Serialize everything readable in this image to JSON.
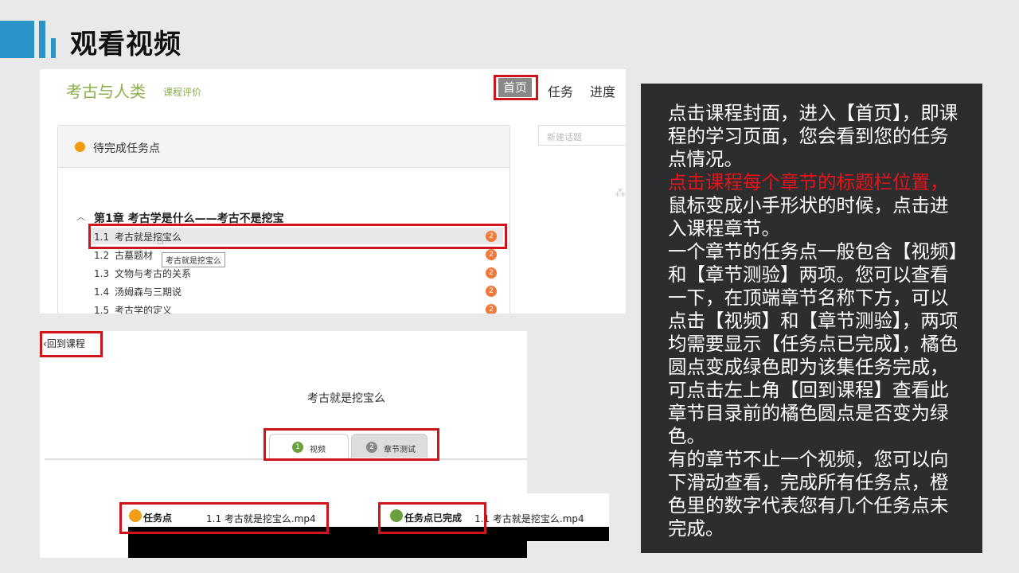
{
  "slide": {
    "title": "观看视频"
  },
  "course_page": {
    "course_title": "考古与人类",
    "course_eval": "课程评价",
    "nav": {
      "home": "首页",
      "task": "任务",
      "progress": "进度"
    },
    "pending_card": {
      "title": "待完成任务点"
    },
    "new_topic_placeholder": "新建话题",
    "chapter": {
      "title": "第1章 考古学是什么——考古不是挖宝",
      "expanded": true
    },
    "sections": [
      {
        "num": "1.1",
        "title": "考古就是挖宝么",
        "badge": "2"
      },
      {
        "num": "1.2",
        "title": "古墓题材",
        "badge": "2"
      },
      {
        "num": "1.3",
        "title": "文物与考古的关系",
        "badge": "2"
      },
      {
        "num": "1.4",
        "title": "汤姆森与三期说",
        "badge": "2"
      },
      {
        "num": "1.5",
        "title": "考古学的定义",
        "badge": "2"
      }
    ],
    "tooltip": "考古就是挖宝么"
  },
  "chapter_page": {
    "back_label": "回到课程",
    "title": "考古就是挖宝么",
    "tabs": [
      {
        "num": "1",
        "label": "视频",
        "color": "#6aa13c",
        "active": true
      },
      {
        "num": "2",
        "label": "章节测试",
        "color": "#888888",
        "active": false
      }
    ],
    "task_pending": {
      "label": "任务点",
      "file": "1.1 考古就是挖宝么.mp4",
      "dot_color": "#f0a018"
    },
    "task_done": {
      "label": "任务点已完成",
      "file": "1.1 考古就是挖宝么.mp4",
      "dot_color": "#6aa13c"
    }
  },
  "instructions": {
    "p1": "点击课程封面，进入【首页】，即课程的学习页面，您会看到您的任务点情况。",
    "p2_red": "点击课程每个章节的标题栏位置，",
    "p3": "鼠标变成小手形状的时候，点击进入课程章节。",
    "p4": "一个章节的任务点一般包含【视频】和【章节测验】两项。您可以查看一下，在顶端章节名称下方，可以点击【视频】和【章节测验】，两项均需要显示【任务点已完成】，橘色圆点变成绿色即为该集任务完成，可点击左上角【回到课程】查看此章节目录前的橘色圆点是否变为绿色。",
    "p5": "有的章节不止一个视频，您可以向下滑动查看，完成所有任务点，橙色里的数字代表您有几个任务点未完成。"
  },
  "colors": {
    "accent": "#2a93c8",
    "highlight_frame": "#d0141c",
    "panel_bg": "#2b2d2f",
    "course_green": "#8ab04a",
    "badge_orange": "#f07a3a"
  }
}
